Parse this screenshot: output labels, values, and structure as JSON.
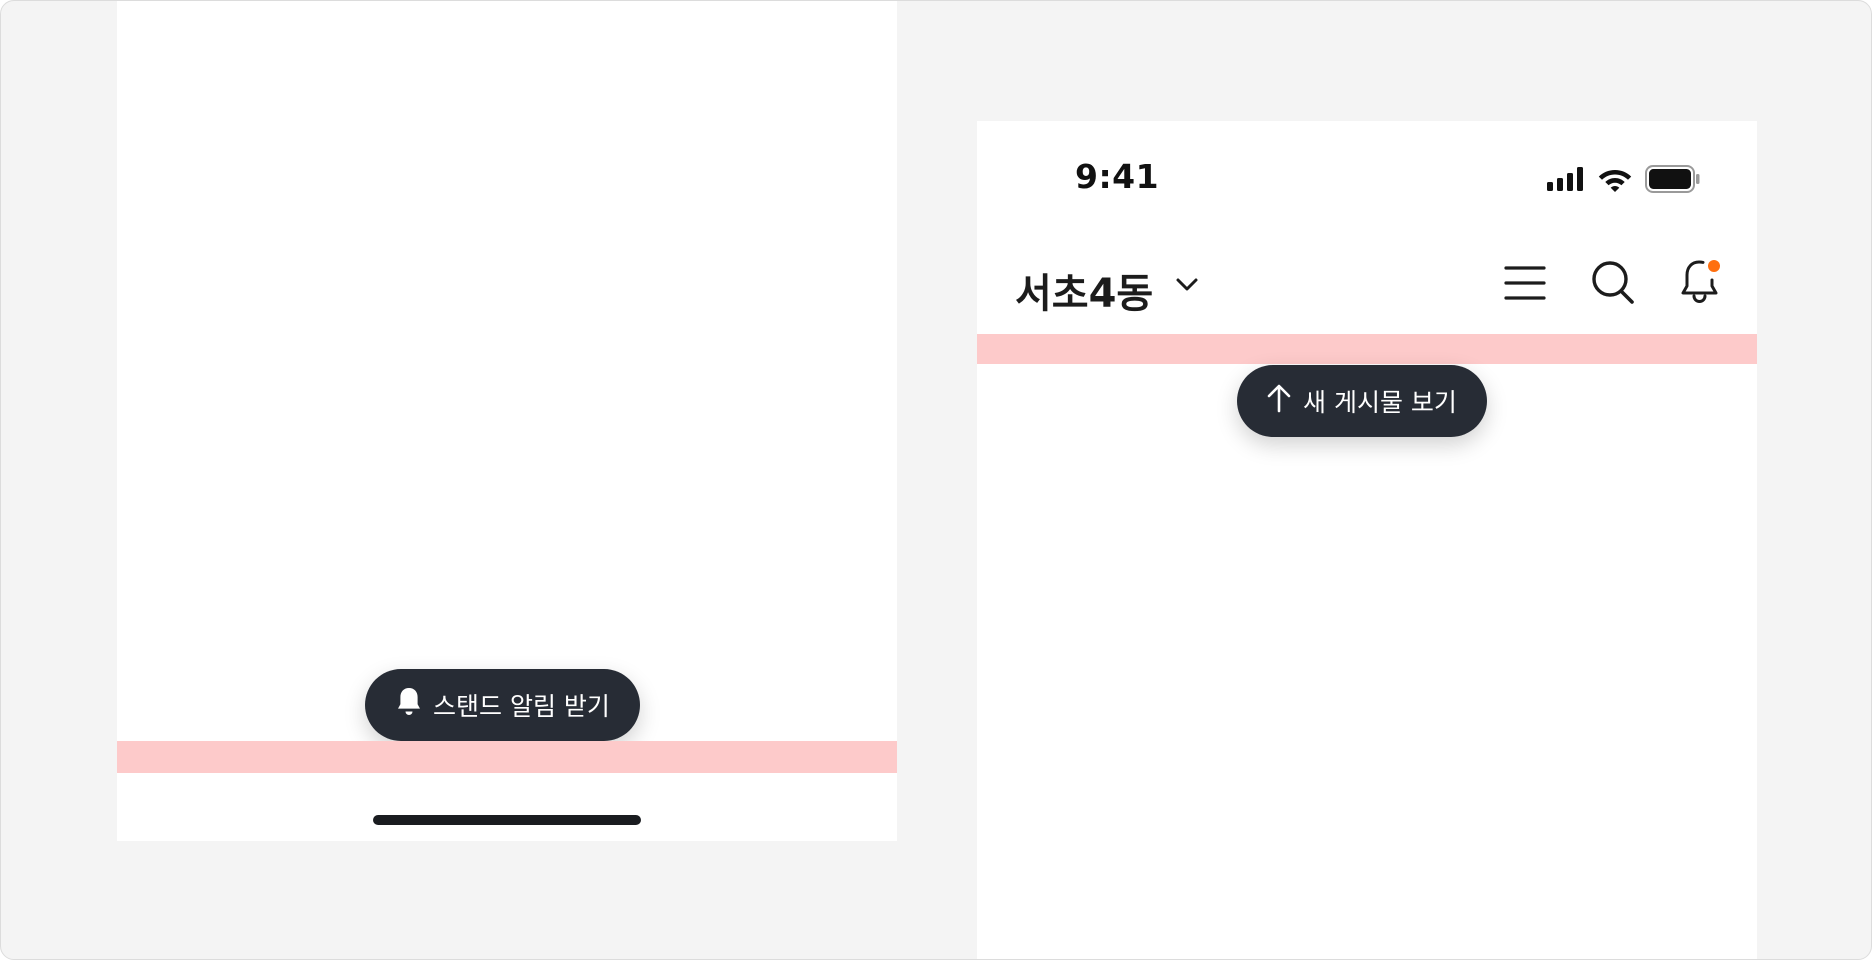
{
  "left_screen": {
    "stand_alert_button": {
      "label": "스탠드 알림 받기",
      "icon": "bell-filled-icon"
    }
  },
  "right_screen": {
    "status_bar": {
      "time": "9:41",
      "icons": [
        "cellular-signal-icon",
        "wifi-icon",
        "battery-icon"
      ]
    },
    "header": {
      "location_title": "서초4동",
      "location_dropdown_icon": "chevron-down-icon",
      "actions": [
        "menu-icon",
        "search-icon",
        "bell-icon"
      ],
      "notification_dot_color": "#ff6f0f"
    },
    "new_posts_button": {
      "label": "새 게시물 보기",
      "icon": "arrow-up-icon"
    }
  },
  "colors": {
    "background": "#f4f4f4",
    "pill_background": "#272c35",
    "safe_area_highlight": "#fdcaca"
  }
}
